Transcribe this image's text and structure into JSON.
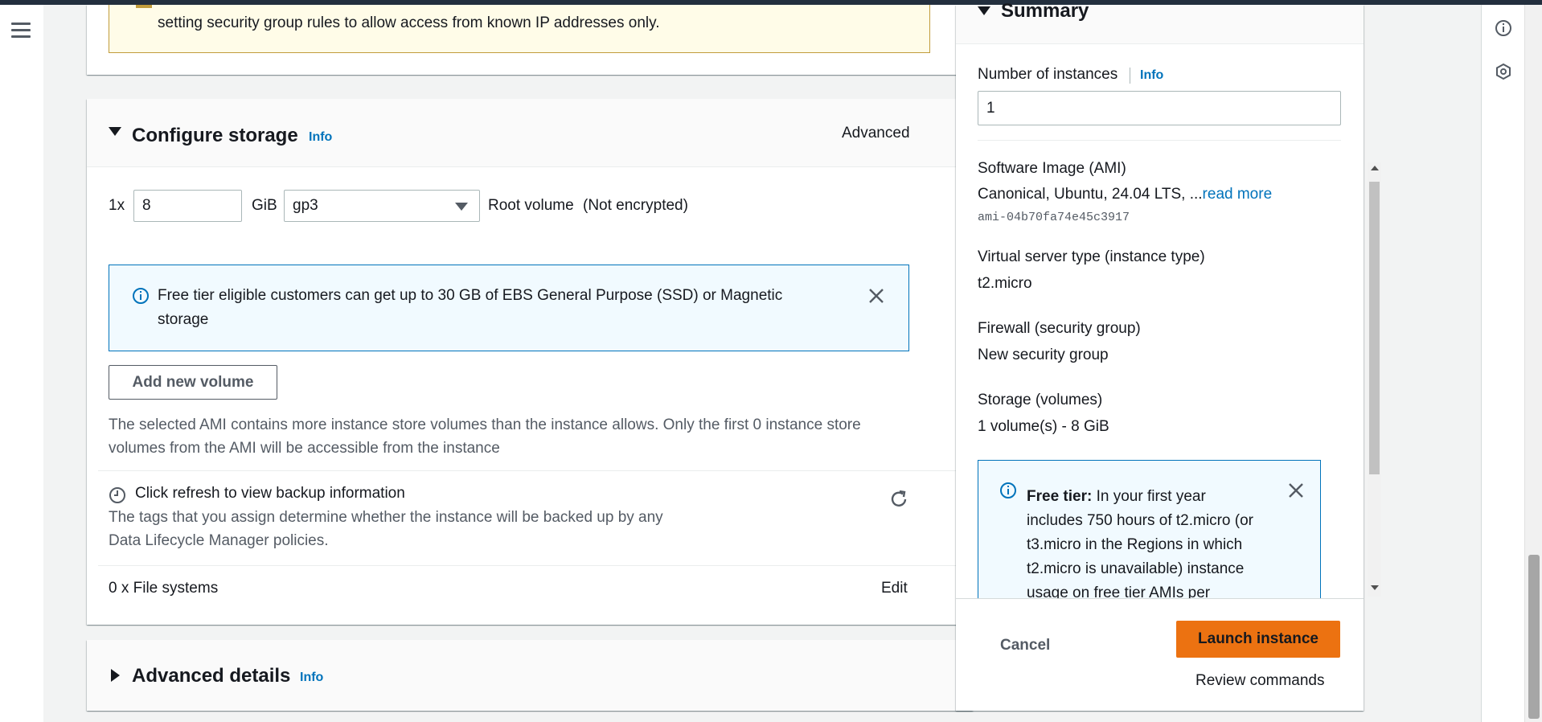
{
  "warning": {
    "text": "setting security group rules to allow access from known IP addresses only."
  },
  "storage": {
    "title": "Configure storage",
    "info": "Info",
    "advanced": "Advanced",
    "multiplier": "1x",
    "size_value": "8",
    "unit": "GiB",
    "volume_type": "gp3",
    "root_volume": "Root volume",
    "encryption": "(Not encrypted)",
    "free_tier_notice_line1": "Free tier eligible customers can get up to 30 GB of EBS General Purpose (SSD) or Magnetic",
    "free_tier_notice_line2": "storage",
    "add_volume": "Add new volume",
    "ami_note_line1": "The selected AMI contains more instance store volumes than the instance allows. Only the first 0 instance store",
    "ami_note_line2": "volumes from the AMI will be accessible from the instance",
    "backup_title": "Click refresh to view backup information",
    "backup_desc_line1": "The tags that you assign determine whether the instance will be backed up by any",
    "backup_desc_line2": "Data Lifecycle Manager policies.",
    "file_systems": "0 x File systems",
    "edit": "Edit"
  },
  "advanced_details": {
    "title": "Advanced details",
    "info": "Info"
  },
  "summary": {
    "title": "Summary",
    "num_instances_label": "Number of instances",
    "info": "Info",
    "num_instances_value": "1",
    "ami_label": "Software Image (AMI)",
    "ami_value": "Canonical, Ubuntu, 24.04 LTS, ...",
    "read_more": "read more",
    "ami_id": "ami-04b70fa74e45c3917",
    "instance_type_label": "Virtual server type (instance type)",
    "instance_type_value": "t2.micro",
    "firewall_label": "Firewall (security group)",
    "firewall_value": "New security group",
    "storage_label": "Storage (volumes)",
    "storage_value": "1 volume(s) - 8 GiB",
    "free_tier_bold": "Free tier:",
    "free_tier_line1": "In your first year",
    "free_tier_line2": "includes 750 hours of t2.micro (or",
    "free_tier_line3": "t3.micro in the Regions in which",
    "free_tier_line4": "t2.micro is unavailable) instance",
    "free_tier_line5": "usage on free tier AMIs per",
    "cancel": "Cancel",
    "launch": "Launch instance",
    "review": "Review commands"
  },
  "colors": {
    "link": "#0073bb",
    "primary": "#ec7211",
    "header": "#232f3e"
  },
  "icons": [
    "menu-icon",
    "info-circle-icon",
    "close-icon",
    "clock-icon",
    "refresh-icon",
    "caret-down-icon",
    "caret-right-icon"
  ]
}
